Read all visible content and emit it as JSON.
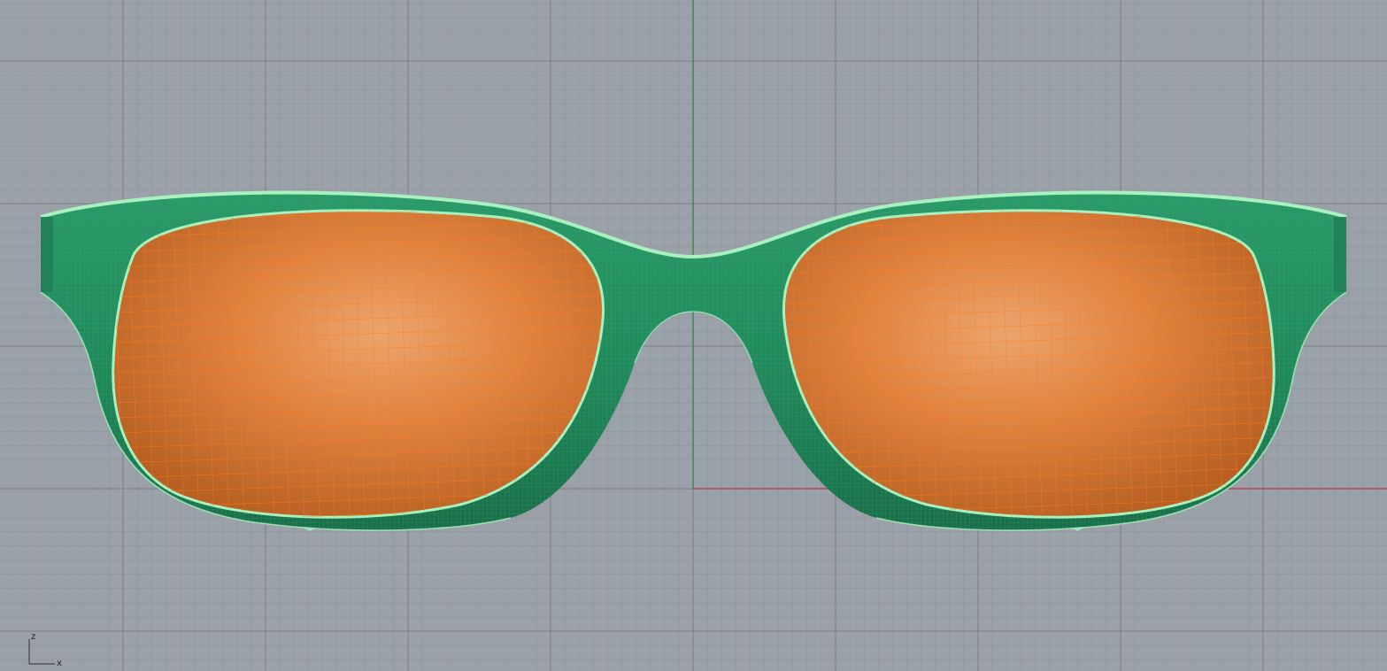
{
  "viewport": {
    "background_color": "#9ba1a9",
    "minor_grid_color": "#8f959d",
    "major_grid_color": "#7b8088",
    "x_axis_color": "#b0343a",
    "z_axis_color": "#2c7d3f",
    "projection": "front"
  },
  "model": {
    "object": "eyeglasses",
    "frame_color": "#218a5c",
    "frame_dark_color": "#1a6e49",
    "frame_edge_color": "#a9f1bf",
    "frame_wire_color": "#2f9d6a",
    "lens_color": "#e0833f",
    "lens_highlight_color": "#eca56d",
    "lens_shadow_color": "#b76022",
    "lens_wire_color": "#ff7a1c"
  },
  "axis_gizmo": {
    "vertical_label": "z",
    "horizontal_label": "x"
  }
}
